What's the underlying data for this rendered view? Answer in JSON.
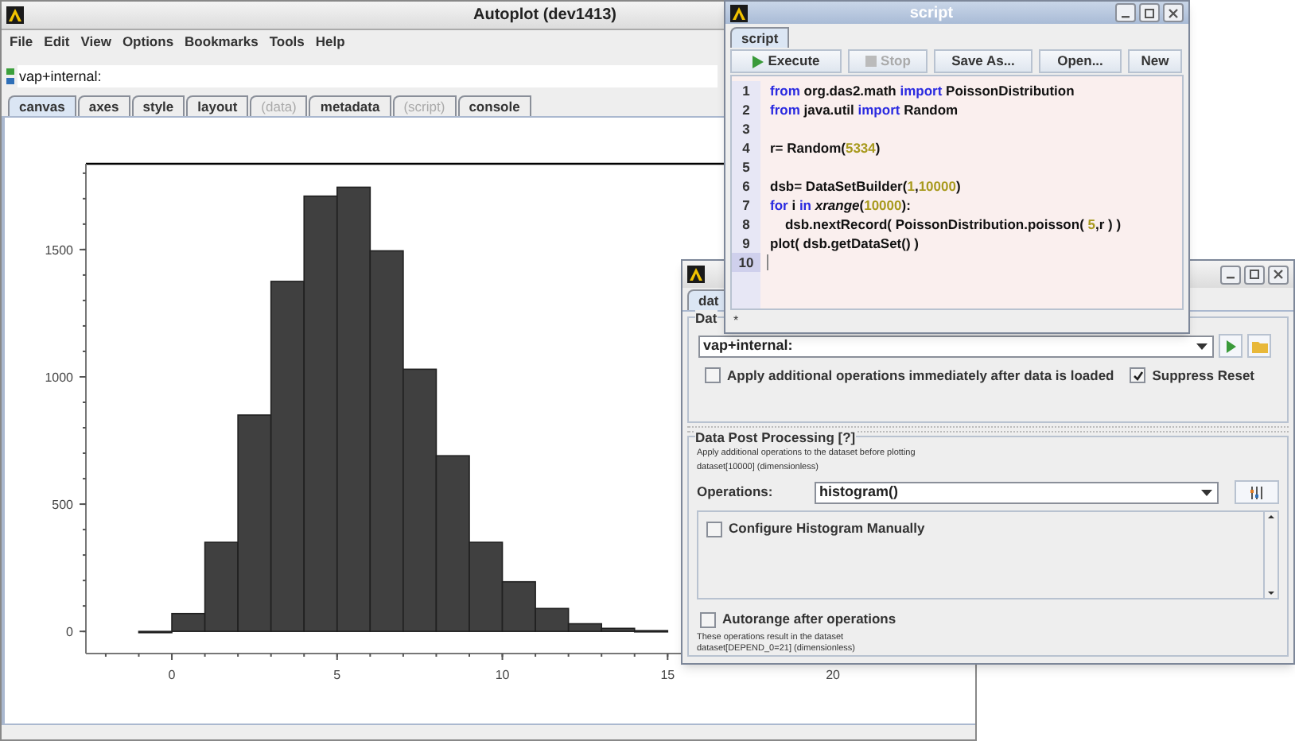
{
  "main_window": {
    "title": "Autoplot (dev1413)",
    "menu": [
      "File",
      "Edit",
      "View",
      "Options",
      "Bookmarks",
      "Tools",
      "Help"
    ],
    "address": "vap+internal:",
    "tabs": [
      {
        "label": "canvas",
        "selected": true,
        "disabled": false
      },
      {
        "label": "axes",
        "selected": false,
        "disabled": false
      },
      {
        "label": "style",
        "selected": false,
        "disabled": false
      },
      {
        "label": "layout",
        "selected": false,
        "disabled": false
      },
      {
        "label": "(data)",
        "selected": false,
        "disabled": true
      },
      {
        "label": "metadata",
        "selected": false,
        "disabled": false
      },
      {
        "label": "(script)",
        "selected": false,
        "disabled": true
      },
      {
        "label": "console",
        "selected": false,
        "disabled": false
      }
    ],
    "chart_data": {
      "type": "bar",
      "x": [
        -0.5,
        0.5,
        1.5,
        2.5,
        3.5,
        4.5,
        5.5,
        6.5,
        7.5,
        8.5,
        9.5,
        10.5,
        11.5,
        12.5,
        13.5,
        14.5
      ],
      "values": [
        0,
        70,
        350,
        850,
        1375,
        1710,
        1745,
        1495,
        1030,
        690,
        350,
        195,
        90,
        30,
        12,
        3
      ],
      "xlim": [
        -2.6,
        21.9
      ],
      "ylim": [
        -87,
        1837
      ],
      "xticks": [
        0,
        5,
        10,
        15,
        20
      ],
      "yticks": [
        0,
        500,
        1000,
        1500
      ]
    }
  },
  "script_window": {
    "title": "script",
    "tab": "script",
    "buttons": [
      {
        "label": "Execute",
        "kind": "run",
        "disabled": false
      },
      {
        "label": "Stop",
        "kind": "stop",
        "disabled": true
      },
      {
        "label": "Save As...",
        "kind": "plain",
        "disabled": false
      },
      {
        "label": "Open...",
        "kind": "plain",
        "disabled": false
      },
      {
        "label": "New",
        "kind": "plain",
        "disabled": false
      }
    ],
    "lines": [
      {
        "number": "1",
        "selected": false,
        "tokens": [
          {
            "text": "from",
            "kind": "keyword"
          },
          {
            "text": " org.das2.math ",
            "kind": "plain"
          },
          {
            "text": "import",
            "kind": "keyword"
          },
          {
            "text": " PoissonDistribution",
            "kind": "plain"
          }
        ]
      },
      {
        "number": "2",
        "selected": false,
        "tokens": [
          {
            "text": "from",
            "kind": "keyword"
          },
          {
            "text": " java.util ",
            "kind": "plain"
          },
          {
            "text": "import",
            "kind": "keyword"
          },
          {
            "text": " Random",
            "kind": "plain"
          }
        ]
      },
      {
        "number": "3",
        "selected": false
      },
      {
        "number": "4",
        "selected": false,
        "tokens": [
          {
            "text": "r= Random(",
            "kind": "plain"
          },
          {
            "text": "5334",
            "kind": "number"
          },
          {
            "text": ")",
            "kind": "plain"
          }
        ]
      },
      {
        "number": "5",
        "selected": false
      },
      {
        "number": "6",
        "selected": false,
        "tokens": [
          {
            "text": "dsb= DataSetBuilder(",
            "kind": "plain"
          },
          {
            "text": "1",
            "kind": "number"
          },
          {
            "text": ",",
            "kind": "plain"
          },
          {
            "text": "10000",
            "kind": "number"
          },
          {
            "text": ")",
            "kind": "plain"
          }
        ]
      },
      {
        "number": "7",
        "selected": false,
        "tokens": [
          {
            "text": "for",
            "kind": "keyword"
          },
          {
            "text": " i ",
            "kind": "plain"
          },
          {
            "text": "in",
            "kind": "keyword"
          },
          {
            "text": " xrange",
            "kind": "builtin"
          },
          {
            "text": "(",
            "kind": "plain"
          },
          {
            "text": "10000",
            "kind": "number"
          },
          {
            "text": "):",
            "kind": "plain"
          }
        ]
      },
      {
        "number": "8",
        "selected": false,
        "tokens": [
          {
            "text": "    dsb.nextRecord( PoissonDistribution.poisson( ",
            "kind": "plain"
          },
          {
            "text": "5",
            "kind": "number"
          },
          {
            "text": ",r ) )",
            "kind": "plain"
          }
        ]
      },
      {
        "number": "9",
        "selected": false,
        "tokens": [
          {
            "text": "plot( dsb.getDataSet() )",
            "kind": "plain"
          }
        ]
      },
      {
        "number": "10",
        "selected": true
      }
    ],
    "status": "*"
  },
  "data_window": {
    "tab": "dat",
    "source_group": "Dat",
    "source": "vap+internal:",
    "apply_immediately": {
      "label": "Apply additional operations immediately after data is loaded",
      "checked": false
    },
    "suppress_reset": {
      "label": "Suppress Reset",
      "checked": true
    },
    "post_processing": {
      "title": "Data Post Processing [?]",
      "hint": "Apply additional operations to the dataset before plotting",
      "input_description": "dataset[10000] (dimensionless)",
      "operations_label": "Operations:",
      "operations": "histogram()",
      "options": [
        {
          "label": "Configure Histogram Manually",
          "checked": false
        }
      ],
      "autorange": {
        "label": "Autorange after operations",
        "checked": false
      },
      "result_note": [
        "These operations result in the dataset",
        "dataset[DEPEND_0=21] (dimensionless)"
      ]
    }
  }
}
